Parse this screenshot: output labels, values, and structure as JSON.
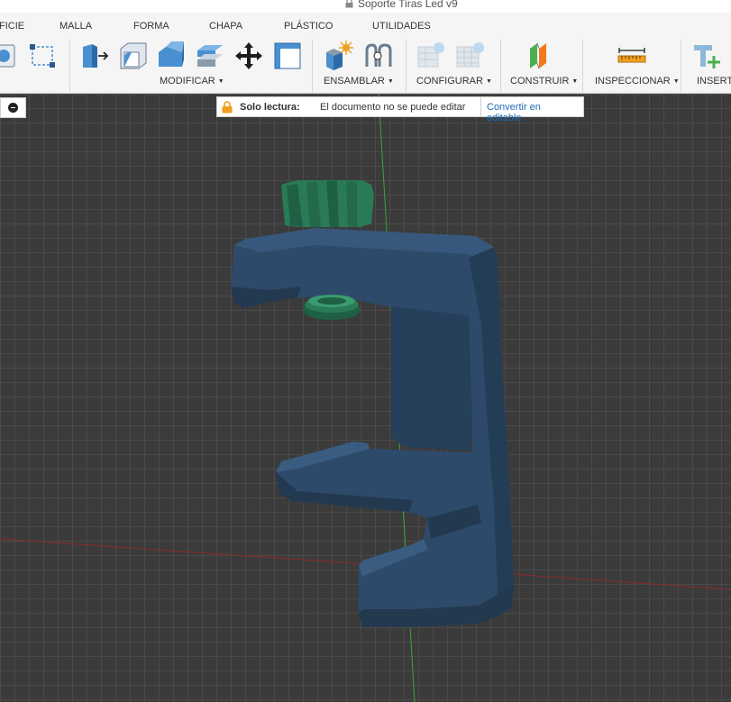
{
  "window": {
    "title": "Soporte Tiras Led v9"
  },
  "tabs": [
    "FICIE",
    "MALLA",
    "FORMA",
    "CHAPA",
    "PLÁSTICO",
    "UTILIDADES"
  ],
  "groups": {
    "modificar": "MODIFICAR",
    "ensamblar": "ENSAMBLAR",
    "configurar": "CONFIGURAR",
    "construir": "CONSTRUIR",
    "inspeccionar": "INSPECCIONAR",
    "insertar": "INSERTA"
  },
  "readonly_bar": {
    "label": "Solo lectura:",
    "message": "El documento no se puede editar",
    "action": "Convertir en editable"
  },
  "colors": {
    "accent": "#1f6bb5",
    "lock": "#f0a020",
    "model_body": "#2e4a6a",
    "model_part": "#2a7a58"
  },
  "icons": {
    "window_lock": "lock-icon",
    "readonly_lock": "lock-icon",
    "viewport_toggle": "minus-circle-icon"
  }
}
